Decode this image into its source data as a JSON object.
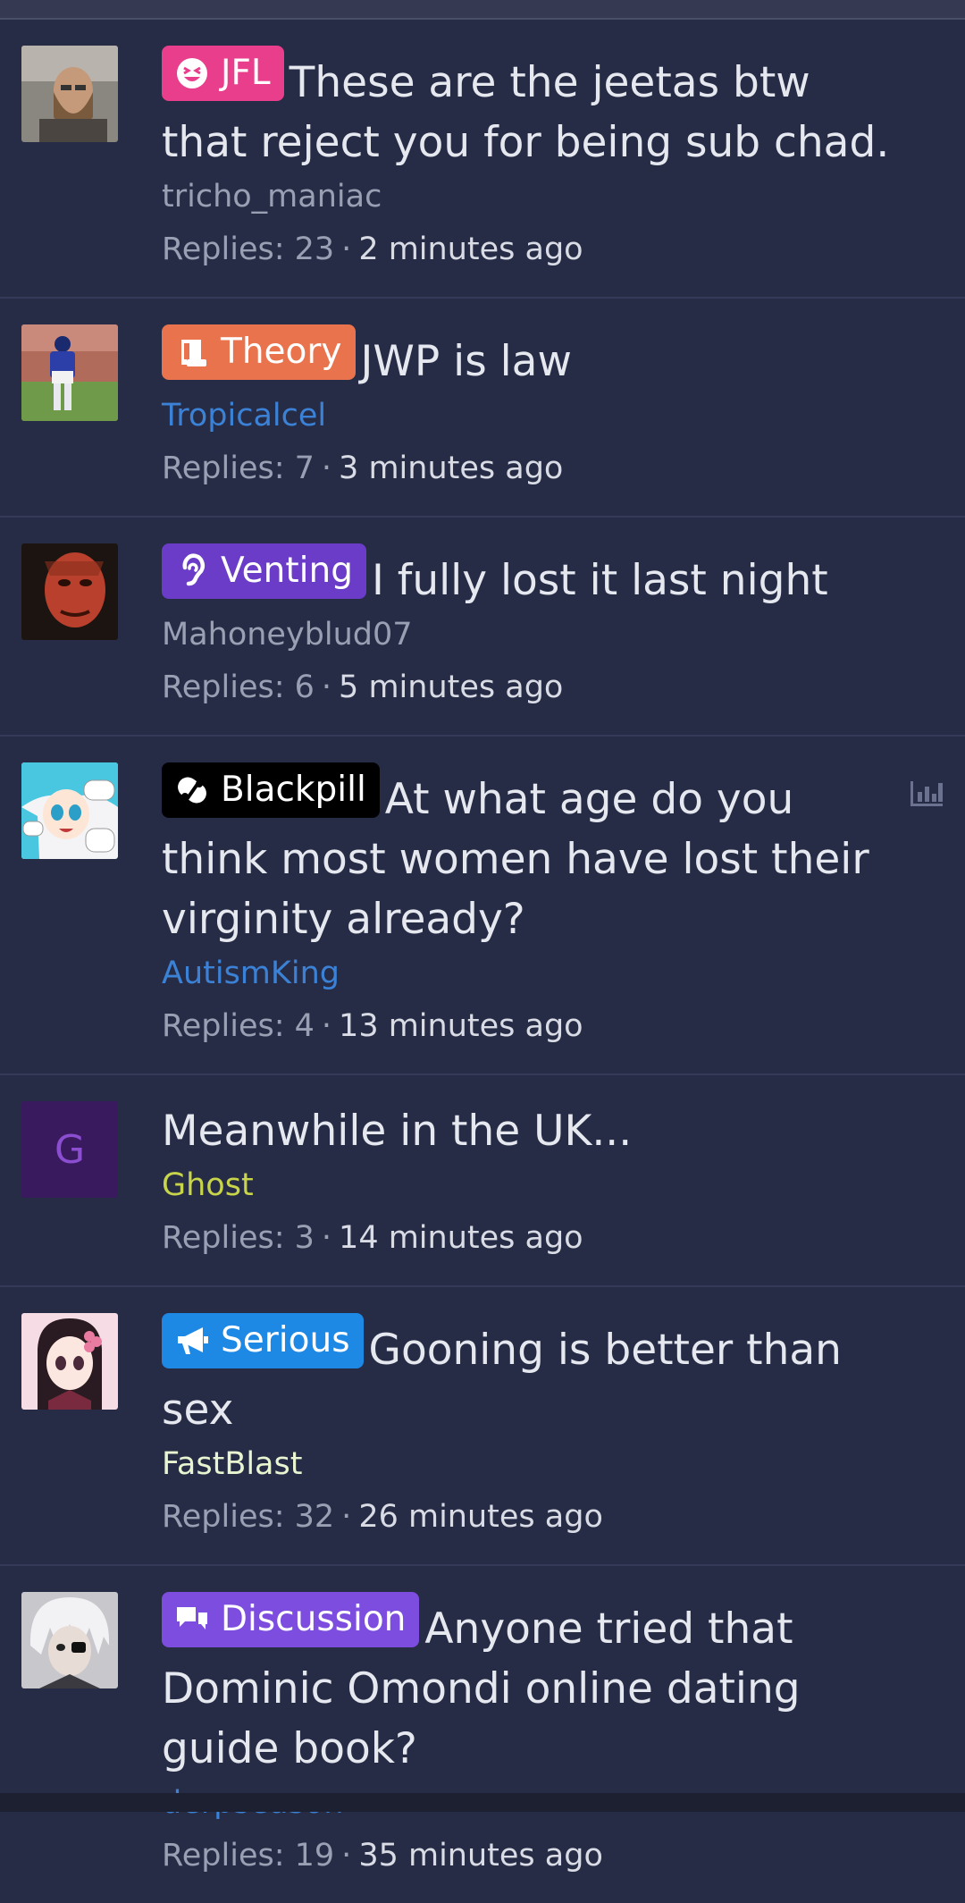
{
  "threads": [
    {
      "prefix": {
        "label": "JFL",
        "color": "#e83e8c",
        "icon": "laughing-face-icon"
      },
      "title": "These are the jeetas btw that reject you for being sub chad.",
      "author": "tricho_maniac",
      "author_color": "#9aa0b4",
      "replies": "Replies: 23",
      "time": "2 minutes ago"
    },
    {
      "prefix": {
        "label": "Theory",
        "color": "#e8734d",
        "icon": "scroll-icon"
      },
      "title": "JWP is law",
      "author": "Tropicalcel",
      "author_color": "#3b82d6",
      "replies": "Replies: 7",
      "time": "3 minutes ago"
    },
    {
      "prefix": {
        "label": "Venting",
        "color": "#6a3cc8",
        "icon": "ear-icon"
      },
      "title": "I fully lost it last night",
      "author": "Mahoneyblud07",
      "author_color": "#9aa0b4",
      "replies": "Replies: 6",
      "time": "5 minutes ago"
    },
    {
      "prefix": {
        "label": "Blackpill",
        "color": "#000000",
        "icon": "pill-icon"
      },
      "title": "At what age do you think most women have lost their virginity already?",
      "author": "AutismKing",
      "author_color": "#3b82d6",
      "replies": "Replies: 4",
      "time": "13 minutes ago",
      "has_poll": true
    },
    {
      "prefix": null,
      "avatar_letter": "G",
      "title": "Meanwhile in the UK...",
      "author": "Ghost",
      "author_color": "#c8d44a",
      "replies": "Replies: 3",
      "time": "14 minutes ago"
    },
    {
      "prefix": {
        "label": "Serious",
        "color": "#1e88e5",
        "icon": "megaphone-icon"
      },
      "title": "Gooning is better than sex",
      "author": "FastBlast",
      "author_color": "#e8f5d0",
      "replies": "Replies: 32",
      "time": "26 minutes ago"
    },
    {
      "prefix": {
        "label": "Discussion",
        "color": "#7c4dde",
        "icon": "chat-bubbles-icon"
      },
      "title": "Anyone tried that Dominic Omondi online dating guide book?",
      "author": "derpseason",
      "author_color": "#3b82d6",
      "replies": "Replies: 19",
      "time": "35 minutes ago"
    }
  ]
}
